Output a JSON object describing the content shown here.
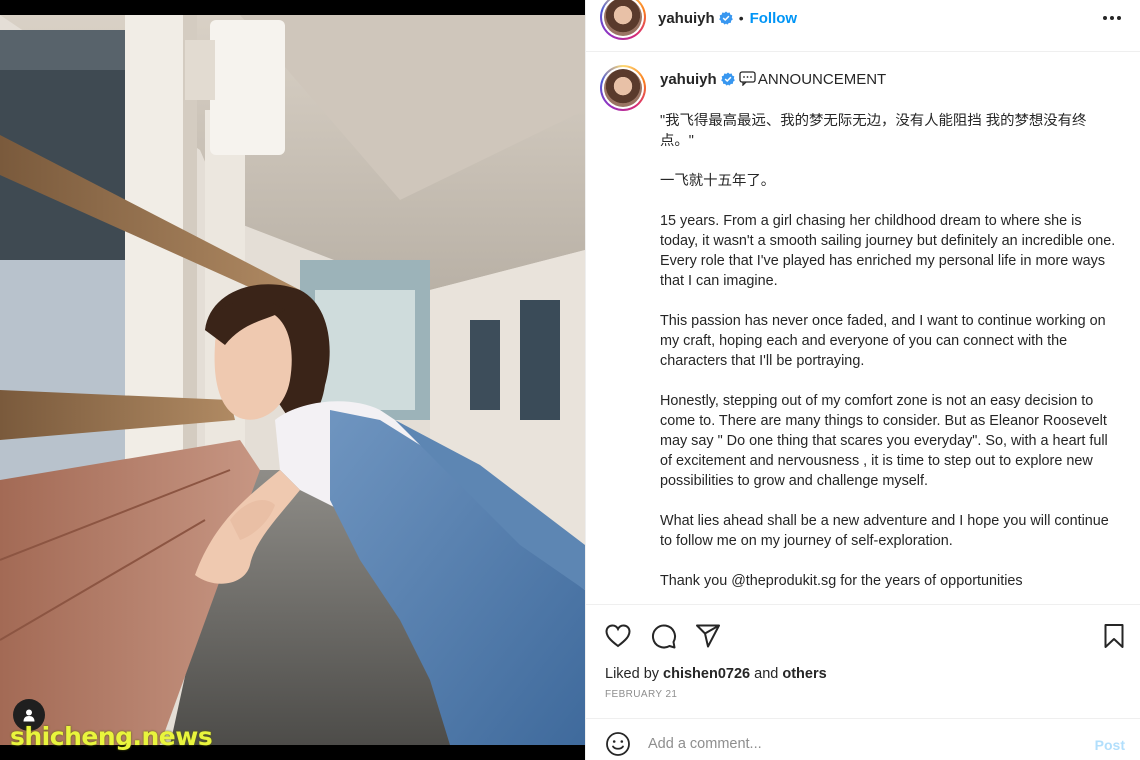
{
  "photo": {
    "alt_subject": "woman-leaning-on-railing",
    "watermark": "shicheng.news",
    "user_tag_icon": "user-tag-icon"
  },
  "header": {
    "username": "yahuiyh",
    "separator": "•",
    "follow_label": "Follow",
    "more_icon": "more-options-icon"
  },
  "caption": {
    "username": "yahuiyh",
    "announcement": "ANNOUNCEMENT",
    "paragraphs": [
      "\"我飞得最高最远、我的梦无际无边，没有人能阻挡 我的梦想没有终点。\"",
      "一飞就十五年了。",
      "15 years. From a girl chasing her childhood dream to where she is today, it wasn't a smooth sailing journey but definitely an incredible one. Every role that I've played has enriched my personal life in more ways that I can imagine.",
      "This passion has never once faded, and I want to continue working on my craft, hoping each and everyone of you can connect with the characters that I'll be portraying.",
      "Honestly, stepping out of my comfort zone is not an easy decision to come to. There are many things to consider. But as Eleanor Roosevelt may say \" Do one thing that scares you everyday\". So, with a heart full of excitement and nervousness , it is time to step out to explore new possibilities to grow and challenge myself.",
      "What lies ahead shall be a new adventure and I hope you will continue to follow me on my journey of self-exploration.",
      "Thank you @theprodukit.sg for the years of opportunities"
    ]
  },
  "actions": {
    "like_icon": "heart-icon",
    "comment_icon": "comment-icon",
    "share_icon": "share-icon",
    "save_icon": "bookmark-icon"
  },
  "likes": {
    "prefix": "Liked by",
    "user": "chishen0726",
    "and": "and",
    "others": "others"
  },
  "date": "February 21",
  "comment": {
    "placeholder": "Add a comment...",
    "post_label": "Post",
    "emoji_icon": "emoji-icon"
  },
  "colors": {
    "link_blue": "#0095f6",
    "post_disabled": "#b2dffc",
    "verified_blue": "#3897f0",
    "text_primary": "#262626",
    "text_secondary": "#8e8e8e",
    "watermark_yellow": "#e9f53d"
  }
}
